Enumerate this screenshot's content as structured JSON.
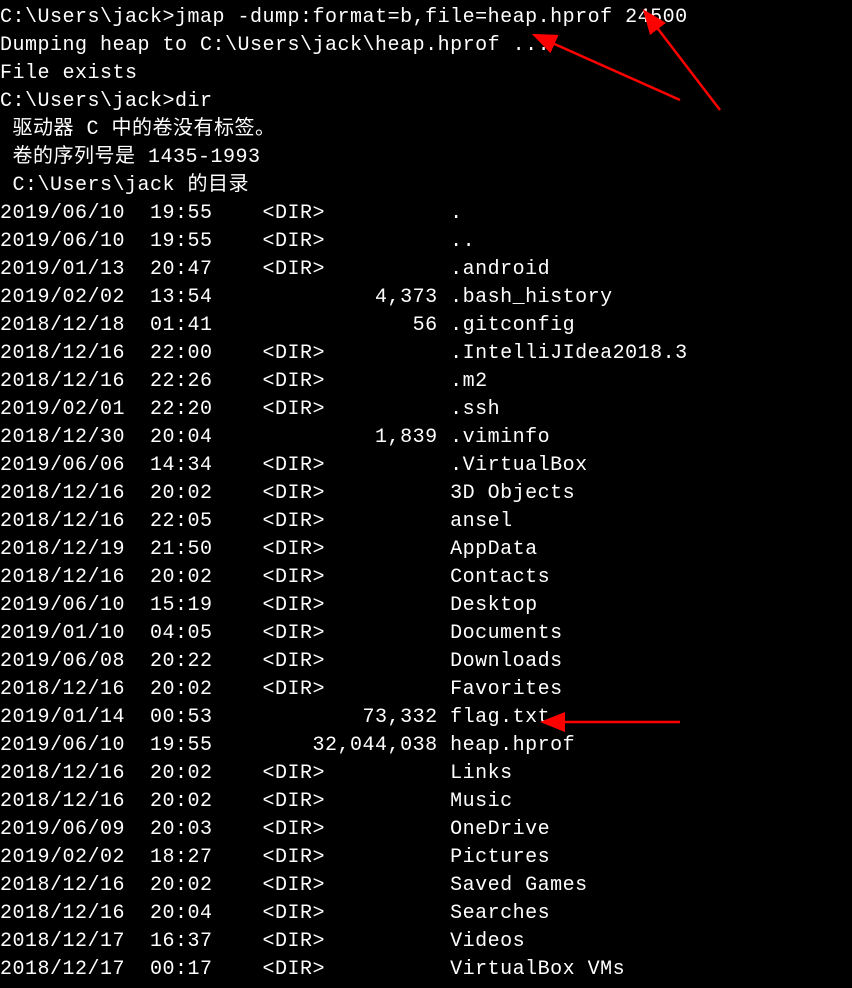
{
  "prompt1_prefix": "C:\\Users\\jack>",
  "command1": "jmap -dump:format=b,file=heap.hprof 24500",
  "output1_line1": "Dumping heap to C:\\Users\\jack\\heap.hprof ...",
  "output1_line2": "File exists",
  "blank": "",
  "prompt2_prefix": "C:\\Users\\jack>",
  "command2": "dir",
  "dir_header1": " 驱动器 C 中的卷没有标签。",
  "dir_header2": " 卷的序列号是 1435-1993",
  "dir_header3": " C:\\Users\\jack 的目录",
  "rows": [
    "2019/06/10  19:55    <DIR>          .",
    "2019/06/10  19:55    <DIR>          ..",
    "2019/01/13  20:47    <DIR>          .android",
    "2019/02/02  13:54             4,373 .bash_history",
    "2018/12/18  01:41                56 .gitconfig",
    "2018/12/16  22:00    <DIR>          .IntelliJIdea2018.3",
    "2018/12/16  22:26    <DIR>          .m2",
    "2019/02/01  22:20    <DIR>          .ssh",
    "2018/12/30  20:04             1,839 .viminfo",
    "2019/06/06  14:34    <DIR>          .VirtualBox",
    "2018/12/16  20:02    <DIR>          3D Objects",
    "2018/12/16  22:05    <DIR>          ansel",
    "2018/12/19  21:50    <DIR>          AppData",
    "2018/12/16  20:02    <DIR>          Contacts",
    "2019/06/10  15:19    <DIR>          Desktop",
    "2019/01/10  04:05    <DIR>          Documents",
    "2019/06/08  20:22    <DIR>          Downloads",
    "2018/12/16  20:02    <DIR>          Favorites",
    "2019/01/14  00:53            73,332 flag.txt",
    "2019/06/10  19:55        32,044,038 heap.hprof",
    "2018/12/16  20:02    <DIR>          Links",
    "2018/12/16  20:02    <DIR>          Music",
    "2019/06/09  20:03    <DIR>          OneDrive",
    "2019/02/02  18:27    <DIR>          Pictures",
    "2018/12/16  20:02    <DIR>          Saved Games",
    "2018/12/16  20:04    <DIR>          Searches",
    "2018/12/17  16:37    <DIR>          Videos",
    "2018/12/17  00:17    <DIR>          VirtualBox VMs"
  ]
}
